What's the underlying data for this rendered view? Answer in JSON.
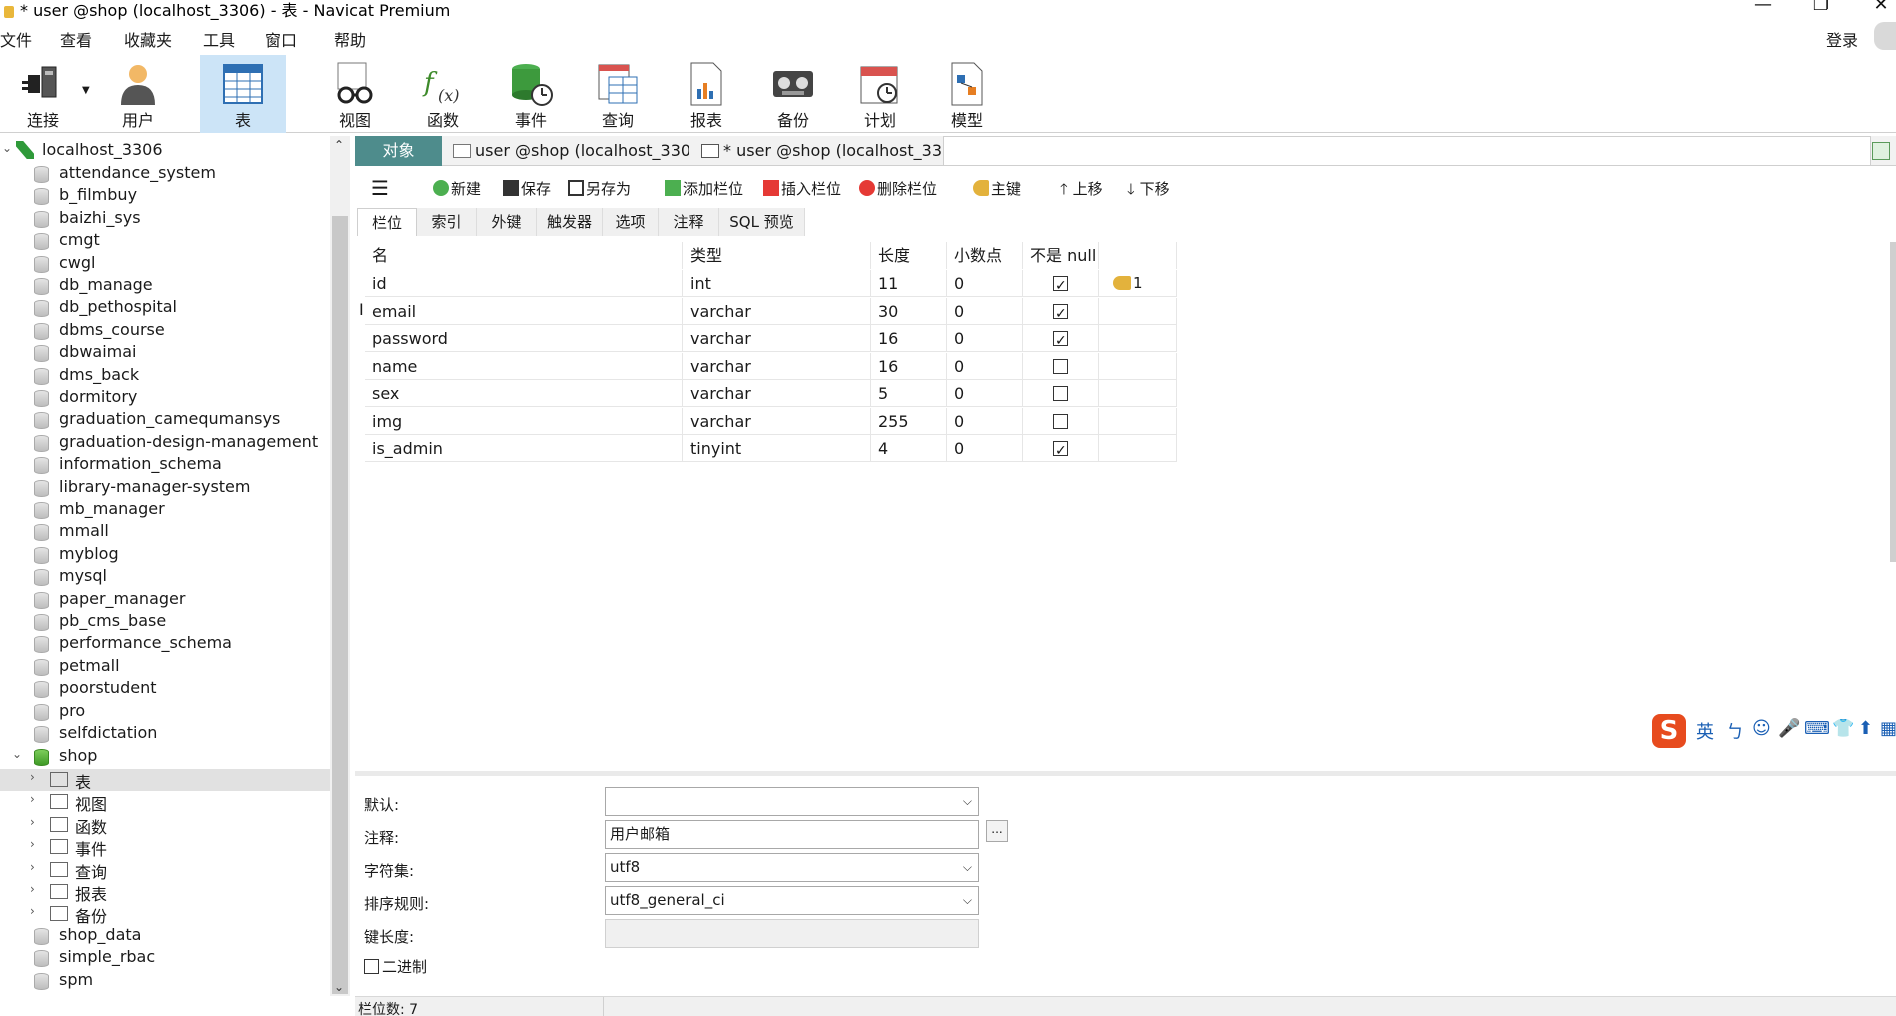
{
  "window": {
    "title": "* user @shop (localhost_3306) - 表 - Navicat Premium",
    "minimize": "—",
    "restore": "❐",
    "close": "✕"
  },
  "menu": [
    "文件",
    "查看",
    "收藏夹",
    "工具",
    "窗口",
    "帮助"
  ],
  "login_label": "登录",
  "toolbar": [
    {
      "label": "连接",
      "icon": "plug-icon"
    },
    {
      "label": "用户",
      "icon": "user-icon"
    },
    {
      "label": "表",
      "icon": "table-icon",
      "active": true
    },
    {
      "label": "视图",
      "icon": "view-glasses-icon"
    },
    {
      "label": "函数",
      "icon": "function-icon"
    },
    {
      "label": "事件",
      "icon": "event-clock-icon"
    },
    {
      "label": "查询",
      "icon": "query-icon"
    },
    {
      "label": "报表",
      "icon": "report-icon"
    },
    {
      "label": "备份",
      "icon": "backup-tape-icon"
    },
    {
      "label": "计划",
      "icon": "schedule-calendar-icon"
    },
    {
      "label": "模型",
      "icon": "model-icon"
    }
  ],
  "tree": {
    "host": "localhost_3306",
    "databases_before": [
      "attendance_system",
      "b_filmbuy",
      "baizhi_sys",
      "cmgt",
      "cwgl",
      "db_manage",
      "db_pethospital",
      "dbms_course",
      "dbwaimai",
      "dms_back",
      "dormitory",
      "graduation_camequmansys",
      "graduation-design-management",
      "information_schema",
      "library-manager-system",
      "mb_manager",
      "mmall",
      "myblog",
      "mysql",
      "paper_manager",
      "pb_cms_base",
      "performance_schema",
      "petmall",
      "poorstudent",
      "pro",
      "selfdictation"
    ],
    "open_db": "shop",
    "open_db_children": [
      {
        "label": "表",
        "icon": "table-icon"
      },
      {
        "label": "视图",
        "icon": "view-glasses-icon"
      },
      {
        "label": "函数",
        "icon": "function-icon"
      },
      {
        "label": "事件",
        "icon": "event-clock-icon"
      },
      {
        "label": "查询",
        "icon": "query-icon"
      },
      {
        "label": "报表",
        "icon": "report-icon"
      },
      {
        "label": "备份",
        "icon": "backup-tape-icon"
      }
    ],
    "databases_after": [
      "shop_data",
      "simple_rbac",
      "spm"
    ]
  },
  "tabs": {
    "objects": "对象",
    "tab1": "user @shop (localhost_3306...",
    "tab2": "* user @shop (localhost_33..."
  },
  "edit_toolbar": {
    "new": "新建",
    "save": "保存",
    "save_as": "另存为",
    "add_field": "添加栏位",
    "insert_field": "插入栏位",
    "delete_field": "删除栏位",
    "primary_key": "主键",
    "move_up": "上移",
    "move_down": "下移"
  },
  "subtabs": [
    "栏位",
    "索引",
    "外键",
    "触发器",
    "选项",
    "注释",
    "SQL 预览"
  ],
  "grid": {
    "headers": [
      "名",
      "类型",
      "长度",
      "小数点",
      "不是 null",
      ""
    ],
    "rows": [
      {
        "name": "id",
        "type": "int",
        "length": "11",
        "decimals": "0",
        "not_null": true,
        "key": "1"
      },
      {
        "name": "email",
        "type": "varchar",
        "length": "30",
        "decimals": "0",
        "not_null": true,
        "key": ""
      },
      {
        "name": "password",
        "type": "varchar",
        "length": "16",
        "decimals": "0",
        "not_null": true,
        "key": ""
      },
      {
        "name": "name",
        "type": "varchar",
        "length": "16",
        "decimals": "0",
        "not_null": false,
        "key": ""
      },
      {
        "name": "sex",
        "type": "varchar",
        "length": "5",
        "decimals": "0",
        "not_null": false,
        "key": ""
      },
      {
        "name": "img",
        "type": "varchar",
        "length": "255",
        "decimals": "0",
        "not_null": false,
        "key": ""
      },
      {
        "name": "is_admin",
        "type": "tinyint",
        "length": "4",
        "decimals": "0",
        "not_null": true,
        "key": ""
      }
    ]
  },
  "ime": {
    "logo": "S",
    "lang": "英",
    "items": [
      "ㄅ",
      "☺",
      "🎤",
      "⌨",
      "👕",
      "⬆",
      "▦"
    ]
  },
  "props": {
    "default_label": "默认:",
    "default_value": "",
    "comment_label": "注释:",
    "comment_value": "用户邮箱",
    "charset_label": "字符集:",
    "charset_value": "utf8",
    "collation_label": "排序规则:",
    "collation_value": "utf8_general_ci",
    "key_length_label": "键长度:",
    "binary_label": "二进制",
    "dots": "..."
  },
  "status": {
    "field_count": "栏位数: 7"
  },
  "colors": {
    "active_tab": "#4e8c8c",
    "selected_tool": "#cce4f7",
    "key": "#e3b23c"
  }
}
